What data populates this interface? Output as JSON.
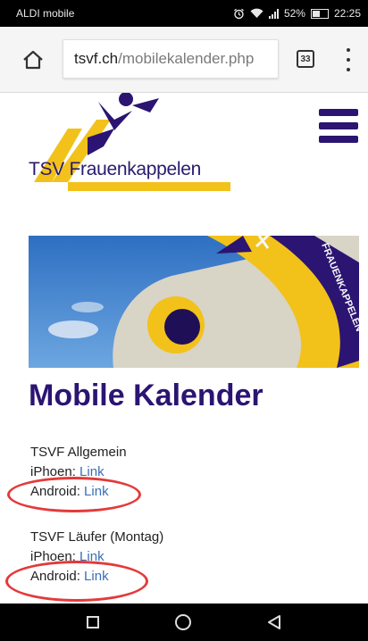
{
  "status_bar": {
    "carrier": "ALDI mobile",
    "battery": "52%",
    "time": "22:25"
  },
  "browser": {
    "url_domain": "tsvf.ch",
    "url_path": "/mobilekalender.php",
    "tab_count": "33",
    "icons": {
      "home": "home-icon",
      "tabs": "tab-switcher-icon",
      "menu": "more-vert-icon"
    }
  },
  "site": {
    "logo_text": "TSV Frauenkappelen",
    "banner_text": "FRAUENKAPPELEN",
    "heading": "Mobile Kalender"
  },
  "calendars": [
    {
      "name": "TSVF Allgemein",
      "ios_label": "iPhoen:",
      "ios_link": "Link",
      "android_label": "Android:",
      "android_link": "Link"
    },
    {
      "name": "TSVF Läufer (Montag)",
      "ios_label": "iPhoen:",
      "ios_link": "Link",
      "android_label": "Android:",
      "android_link": "Link"
    }
  ],
  "colors": {
    "brand_purple": "#2b1472",
    "brand_yellow": "#f2c21a",
    "link_blue": "#3a6fb5",
    "annotation_red": "#e33a3a"
  }
}
